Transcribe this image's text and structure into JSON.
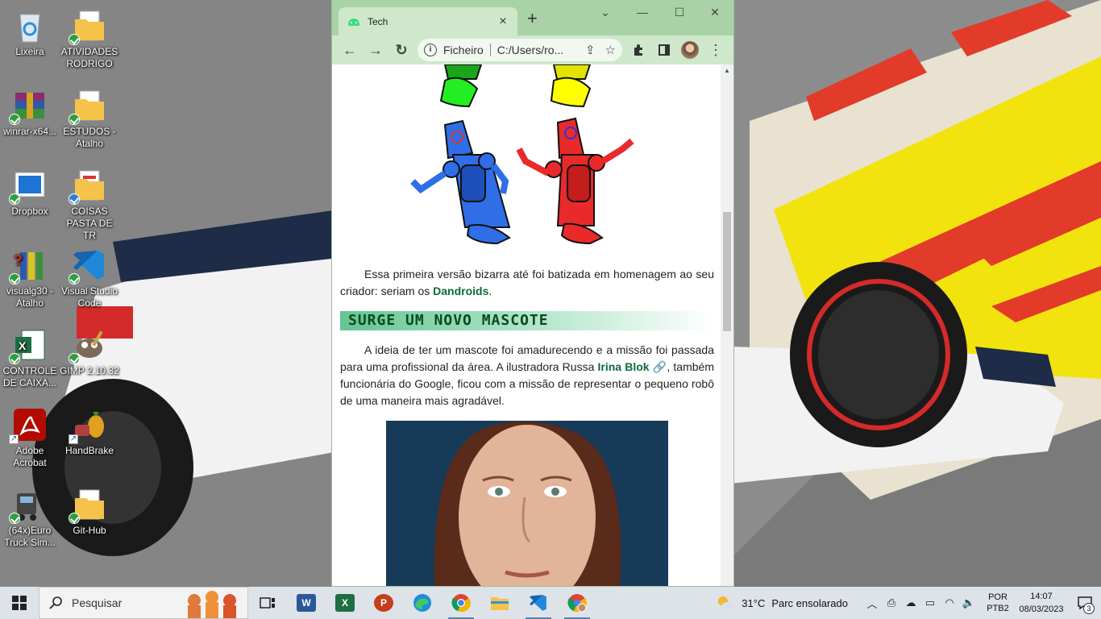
{
  "desktop": {
    "icons": [
      {
        "label": "Lixeira",
        "icon": "recycle-bin-icon"
      },
      {
        "label": "ATIVIDADES RODRIGO",
        "icon": "folder-icon"
      },
      {
        "label": "winrar-x64...",
        "icon": "winrar-icon"
      },
      {
        "label": "ESTUDOS - Atalho",
        "icon": "folder-icon"
      },
      {
        "label": "Dropbox",
        "icon": "dropbox-icon"
      },
      {
        "label": "COISAS PASTA DE TR",
        "icon": "folder-icon"
      },
      {
        "label": "visualg30 - Atalho",
        "icon": "visualg-icon"
      },
      {
        "label": "Visual Studio Code",
        "icon": "vscode-icon"
      },
      {
        "label": "CONTROLE DE CAIXA...",
        "icon": "excel-icon"
      },
      {
        "label": "GIMP 2.10.32",
        "icon": "gimp-icon"
      },
      {
        "label": "Adobe Acrobat",
        "icon": "acrobat-icon"
      },
      {
        "label": "HandBrake",
        "icon": "handbrake-icon"
      },
      {
        "label": "(64x)Euro Truck Sim...",
        "icon": "truck-icon"
      },
      {
        "label": "Git-Hub",
        "icon": "folder-icon"
      }
    ]
  },
  "browser": {
    "tab_title": "Tech",
    "new_tab": "+",
    "close_tab": "×",
    "omnibox_scheme": "Ficheiro",
    "omnibox_url": "C:/Users/ro...",
    "controls": {
      "minimize": "—",
      "maximize": "☐",
      "close": "✕",
      "dropdown": "⌄"
    }
  },
  "page": {
    "para1_text": "Essa primeira versão bizarra até foi batizada em homenagem ao seu criador: seriam os ",
    "para1_bold": "Dandroids",
    "para1_end": ".",
    "section_title": "Surge um novo mascote",
    "para2_a": "A ideia de ter um mascote foi amadurecendo e a missão foi passada para uma profissional da área. A ilustradora Russa ",
    "para2_link": "Irina Blok",
    "para2_b": ", também funcionária do Google, ficou com a missão de representar o pequeno robô de uma maneira mais agradável."
  },
  "taskbar": {
    "search_placeholder": "Pesquisar",
    "apps": [
      "task-view",
      "word",
      "excel",
      "powerpoint",
      "edge",
      "chrome",
      "file-explorer",
      "vscode",
      "chrome-profile"
    ],
    "weather_temp": "31°C",
    "weather_text": "Parc ensolarado",
    "language_1": "POR",
    "language_2": "PTB2",
    "time": "14:07",
    "date": "08/03/2023",
    "notifications": "3"
  },
  "colors": {
    "browser_frame": "#a9d3a6",
    "toolbar": "#cfe8cc",
    "heading_green": "#63c592",
    "link_green": "#0c6a3a"
  }
}
